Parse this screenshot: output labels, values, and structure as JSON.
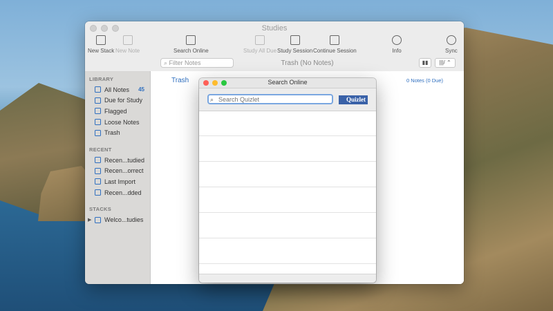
{
  "window": {
    "title": "Studies"
  },
  "toolbar": {
    "new_stack": "New Stack",
    "new_note": "New Note",
    "search_online": "Search Online",
    "study_all_due": "Study All Due",
    "study_session": "Study Session",
    "continue_session": "Continue Session",
    "info": "Info",
    "sync": "Sync"
  },
  "filter": {
    "placeholder": "Filter Notes"
  },
  "header": {
    "title": "Trash (No Notes)"
  },
  "sidebar": {
    "library_heading": "LIBRARY",
    "library": [
      {
        "label": "All Notes",
        "badge": "45"
      },
      {
        "label": "Due for Study"
      },
      {
        "label": "Flagged"
      },
      {
        "label": "Loose Notes"
      },
      {
        "label": "Trash"
      }
    ],
    "recent_heading": "RECENT",
    "recent": [
      {
        "label": "Recen...tudied"
      },
      {
        "label": "Recen...orrect"
      },
      {
        "label": "Last Import"
      },
      {
        "label": "Recen...dded"
      }
    ],
    "stacks_heading": "STACKS",
    "stacks": [
      {
        "label": "Welco...tudies"
      }
    ]
  },
  "content": {
    "title": "Trash",
    "count": "0 Notes (0 Due)"
  },
  "search_panel": {
    "title": "Search Online",
    "placeholder": "Search Quizlet",
    "provider": "Quizlet"
  },
  "colors": {
    "accent": "#2f6fbf",
    "quizlet": "#3a62a8"
  }
}
